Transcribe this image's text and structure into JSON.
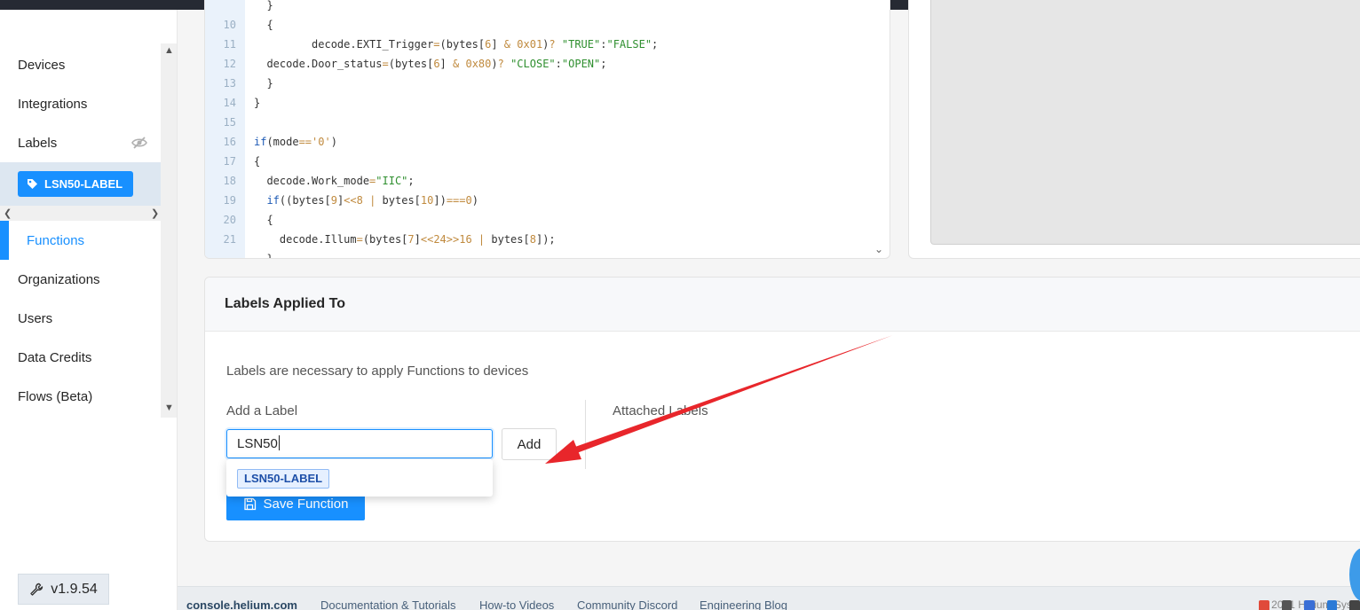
{
  "sidebar": {
    "items": [
      {
        "label": "Devices"
      },
      {
        "label": "Integrations"
      },
      {
        "label": "Labels"
      },
      {
        "label": "Functions"
      },
      {
        "label": "Organizations"
      },
      {
        "label": "Users"
      },
      {
        "label": "Data Credits"
      },
      {
        "label": "Flows (Beta)"
      }
    ],
    "active_label_chip": "LSN50-LABEL",
    "version": "v1.9.54"
  },
  "code": {
    "lines": [
      {
        "n": "10"
      },
      {
        "n": "11"
      },
      {
        "n": "12"
      },
      {
        "n": "13"
      },
      {
        "n": "14"
      },
      {
        "n": "15"
      },
      {
        "n": "16"
      },
      {
        "n": "17"
      },
      {
        "n": "18"
      },
      {
        "n": "19"
      },
      {
        "n": "20"
      },
      {
        "n": "21"
      }
    ]
  },
  "labels_section": {
    "title": "Labels Applied To",
    "help_text": "Labels are necessary to apply Functions to devices",
    "add_label_title": "Add a Label",
    "input_value": "LSN50",
    "add_button": "Add",
    "attached_title": "Attached Labels",
    "suggestion": "LSN50-LABEL",
    "save_button": "Save Function"
  },
  "footer": {
    "brand": "console.helium.com",
    "links": [
      "Documentation & Tutorials",
      "How-to Videos",
      "Community Discord",
      "Engineering Blog"
    ],
    "copyright": "© 2021 Helium Systems"
  },
  "colors": {
    "accent": "#1890ff",
    "annotation_arrow": "#e8262b"
  }
}
